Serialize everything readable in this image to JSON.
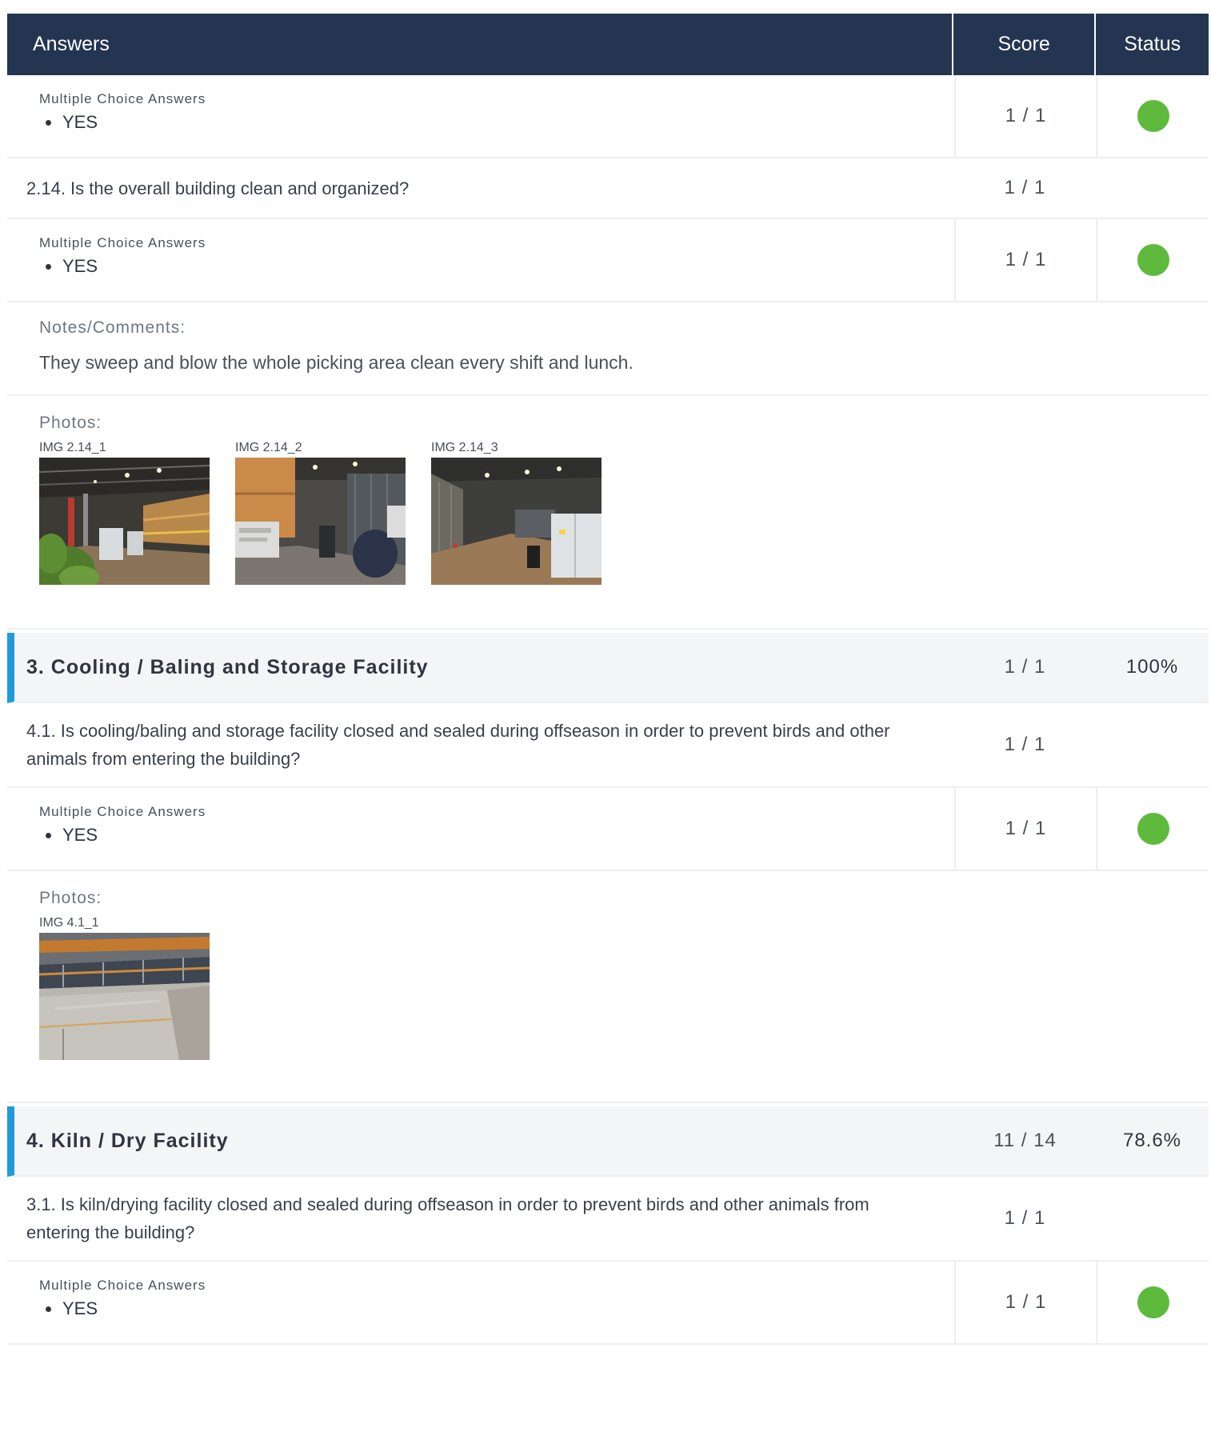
{
  "header": {
    "answers": "Answers",
    "score": "Score",
    "status": "Status"
  },
  "rows": {
    "r1": {
      "label": "Multiple Choice Answers",
      "answer": "YES",
      "score": "1 / 1",
      "status_color": "#5dba3d"
    },
    "q214": {
      "text": "2.14. Is the overall building clean and organized?",
      "score": "1 / 1"
    },
    "r2": {
      "label": "Multiple Choice Answers",
      "answer": "YES",
      "score": "1 / 1",
      "status_color": "#5dba3d"
    },
    "notes": {
      "label": "Notes/Comments:",
      "text": "They sweep and blow the whole picking area clean every shift and lunch."
    },
    "photos1": {
      "label": "Photos:",
      "captions": [
        "IMG 2.14_1",
        "IMG 2.14_2",
        "IMG 2.14_3"
      ]
    },
    "sec3": {
      "title": "3. Cooling / Baling and Storage Facility",
      "score": "1 / 1",
      "percent": "100%"
    },
    "q41": {
      "text": "4.1. Is cooling/baling and storage facility closed and sealed during offseason in order to prevent birds and other animals from entering the building?",
      "score": "1 / 1"
    },
    "r3": {
      "label": "Multiple Choice Answers",
      "answer": "YES",
      "score": "1 / 1",
      "status_color": "#5dba3d"
    },
    "photos2": {
      "label": "Photos:",
      "captions": [
        "IMG 4.1_1"
      ]
    },
    "sec4": {
      "title": "4. Kiln / Dry Facility",
      "score": "11 / 14",
      "percent": "78.6%"
    },
    "q31": {
      "text": "3.1. Is kiln/drying facility closed and sealed during offseason in order to prevent birds and other animals from entering the building?",
      "score": "1 / 1"
    },
    "r4": {
      "label": "Multiple Choice Answers",
      "answer": "YES",
      "score": "1 / 1",
      "status_color": "#5dba3d"
    }
  }
}
